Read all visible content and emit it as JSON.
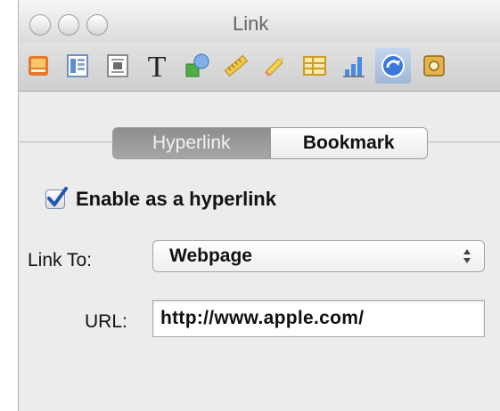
{
  "window": {
    "title": "Link"
  },
  "toolbar": {
    "tools": [
      {
        "icon": "document-icon"
      },
      {
        "icon": "layout-icon"
      },
      {
        "icon": "wrap-icon"
      },
      {
        "icon": "text-icon",
        "glyph": "T"
      },
      {
        "icon": "graphic-icon"
      },
      {
        "icon": "metrics-icon"
      },
      {
        "icon": "table-icon"
      },
      {
        "icon": "chart-icon"
      },
      {
        "icon": "link-icon",
        "active": true
      },
      {
        "icon": "quicktime-icon"
      }
    ]
  },
  "tabs": {
    "hyperlink": "Hyperlink",
    "bookmark": "Bookmark",
    "selected": "Hyperlink"
  },
  "enable": {
    "label": "Enable as a hyperlink",
    "checked": true
  },
  "link_to": {
    "label": "Link To:",
    "value": "Webpage"
  },
  "url": {
    "label": "URL:",
    "value": "http://www.apple.com/"
  },
  "colors": {
    "accent": "#3b79d6",
    "selected_tab": "#999999"
  }
}
